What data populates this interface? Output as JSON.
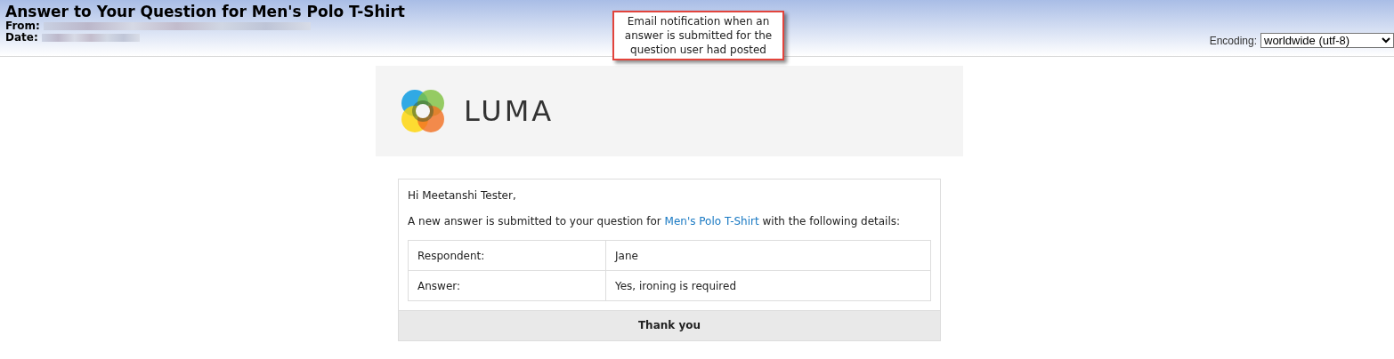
{
  "header": {
    "title": "Answer to Your Question for Men's Polo T-Shirt",
    "fields": [
      {
        "label": "From:"
      },
      {
        "label": "Date:"
      }
    ],
    "encoding": {
      "label": "Encoding:",
      "value": "worldwide (utf-8)"
    }
  },
  "annotation": {
    "text": "Email notification when an answer is submitted for the question user had posted"
  },
  "email": {
    "logo": {
      "wordmark": "LUMA"
    },
    "greeting": "Hi Meetanshi Tester,",
    "intro_before": "A new answer is submitted to your question for",
    "product_link": "Men's Polo T-Shirt",
    "intro_after": "with the following details:",
    "details": [
      {
        "label": "Respondent:",
        "value": "Jane"
      },
      {
        "label": "Answer:",
        "value": "Yes, ironing is required"
      }
    ],
    "footer": "Thank you"
  }
}
